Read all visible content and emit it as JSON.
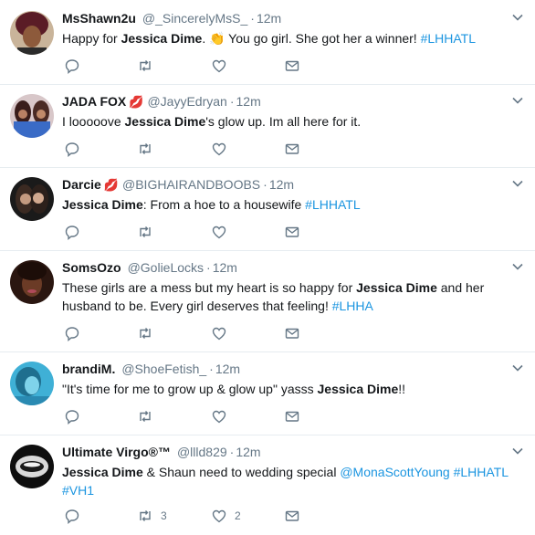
{
  "tweets": [
    {
      "name": "MsShawn2u",
      "emoji": "",
      "handle": "@_SincerelyMsS_",
      "time": "12m",
      "segments": [
        {
          "t": "Happy for ",
          "s": "n"
        },
        {
          "t": "Jessica Dime",
          "s": "b"
        },
        {
          "t": ". ",
          "s": "n"
        },
        {
          "t": "👏",
          "s": "e"
        },
        {
          "t": " You go girl. She got her a winner! ",
          "s": "n"
        },
        {
          "t": "#LHHATL",
          "s": "h"
        }
      ],
      "reply_count": "",
      "retweet_count": "",
      "like_count": ""
    },
    {
      "name": "JADA FOX",
      "emoji": "💋",
      "handle": "@JayyEdryan",
      "time": "12m",
      "segments": [
        {
          "t": "I looooove ",
          "s": "n"
        },
        {
          "t": "Jessica Dime",
          "s": "b"
        },
        {
          "t": "'s glow up. Im all here for it.",
          "s": "n"
        }
      ],
      "reply_count": "",
      "retweet_count": "",
      "like_count": ""
    },
    {
      "name": "Darcie",
      "emoji": "💋",
      "handle": "@BIGHAIRANDBOOBS",
      "time": "12m",
      "segments": [
        {
          "t": "Jessica Dime",
          "s": "b"
        },
        {
          "t": ": From a hoe to a housewife ",
          "s": "n"
        },
        {
          "t": "#LHHATL",
          "s": "h"
        }
      ],
      "reply_count": "",
      "retweet_count": "",
      "like_count": ""
    },
    {
      "name": "SomsOzo",
      "emoji": "",
      "handle": "@GolieLocks",
      "time": "12m",
      "segments": [
        {
          "t": "These girls are a mess but my heart is so happy for ",
          "s": "n"
        },
        {
          "t": "Jessica Dime",
          "s": "b"
        },
        {
          "t": " and her husband to be. Every girl deserves that feeling! ",
          "s": "n"
        },
        {
          "t": "#LHHA",
          "s": "h"
        }
      ],
      "reply_count": "",
      "retweet_count": "",
      "like_count": ""
    },
    {
      "name": "brandiM.",
      "emoji": "",
      "handle": "@ShoeFetish_",
      "time": "12m",
      "segments": [
        {
          "t": "\"It's time for me to grow up & glow up\" yasss ",
          "s": "n"
        },
        {
          "t": "Jessica Dime",
          "s": "b"
        },
        {
          "t": "!!",
          "s": "n"
        }
      ],
      "reply_count": "",
      "retweet_count": "",
      "like_count": ""
    },
    {
      "name": "Ultimate Virgo®™",
      "emoji": "",
      "handle": "@llld829",
      "time": "12m",
      "segments": [
        {
          "t": "Jessica Dime",
          "s": "b"
        },
        {
          "t": " & Shaun need to wedding special ",
          "s": "n"
        },
        {
          "t": "@MonaScottYoung",
          "s": "h"
        },
        {
          "t": " ",
          "s": "n"
        },
        {
          "t": "#LHHATL",
          "s": "h"
        },
        {
          "t": " ",
          "s": "n"
        },
        {
          "t": "#VH1",
          "s": "h"
        }
      ],
      "reply_count": "",
      "retweet_count": "3",
      "like_count": "2"
    }
  ],
  "icons": {
    "reply": "reply-icon",
    "retweet": "retweet-icon",
    "like": "heart-icon",
    "dm": "envelope-icon",
    "caret": "chevron-down-icon"
  },
  "colors": {
    "link": "#1b95e0",
    "meta": "#657786",
    "icon": "#657786",
    "text": "#14171a",
    "divider": "#e6ecf0"
  }
}
